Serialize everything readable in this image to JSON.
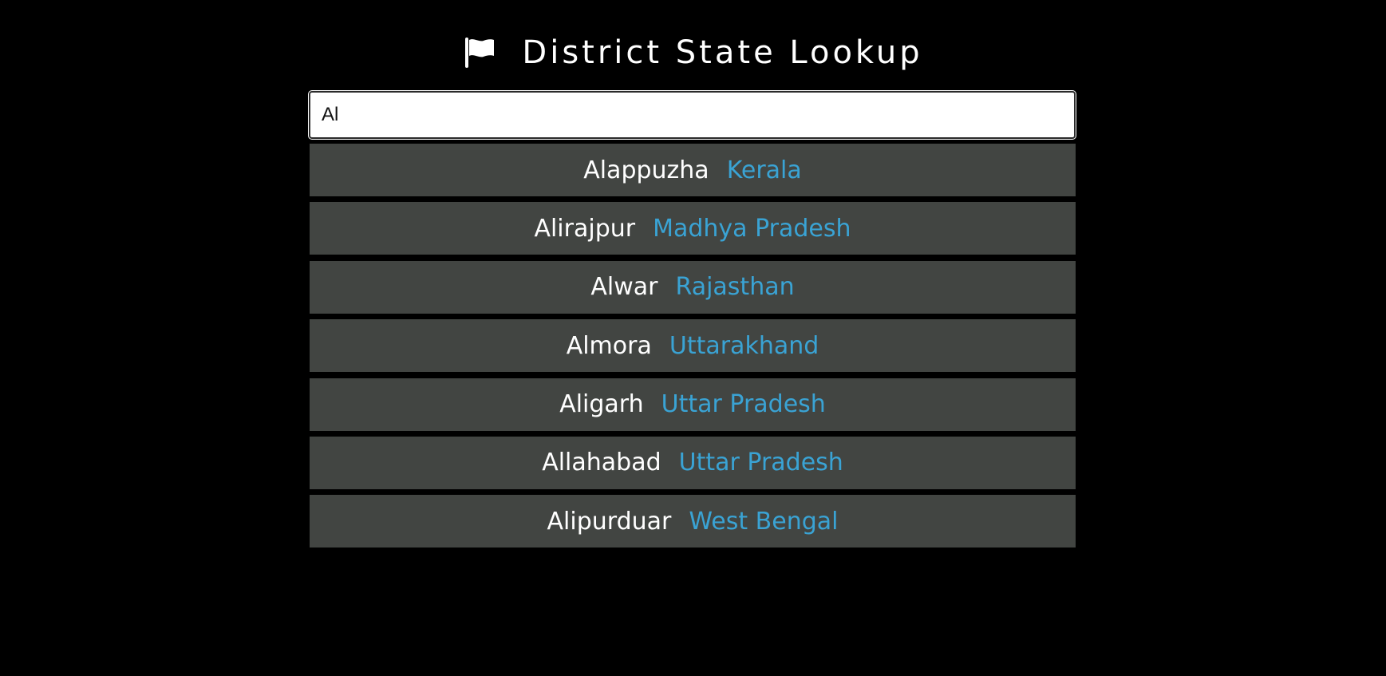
{
  "header": {
    "icon": "flag-icon",
    "title": "District State Lookup"
  },
  "search": {
    "value": "Al",
    "placeholder": ""
  },
  "colors": {
    "background": "#000000",
    "row_background": "#424542",
    "district_text": "#ffffff",
    "state_text": "#3aa3d4"
  },
  "results": [
    {
      "district": "Alappuzha",
      "state": "Kerala"
    },
    {
      "district": "Alirajpur",
      "state": "Madhya Pradesh"
    },
    {
      "district": "Alwar",
      "state": "Rajasthan"
    },
    {
      "district": "Almora",
      "state": "Uttarakhand"
    },
    {
      "district": "Aligarh",
      "state": "Uttar Pradesh"
    },
    {
      "district": "Allahabad",
      "state": "Uttar Pradesh"
    },
    {
      "district": "Alipurduar",
      "state": "West Bengal"
    }
  ]
}
